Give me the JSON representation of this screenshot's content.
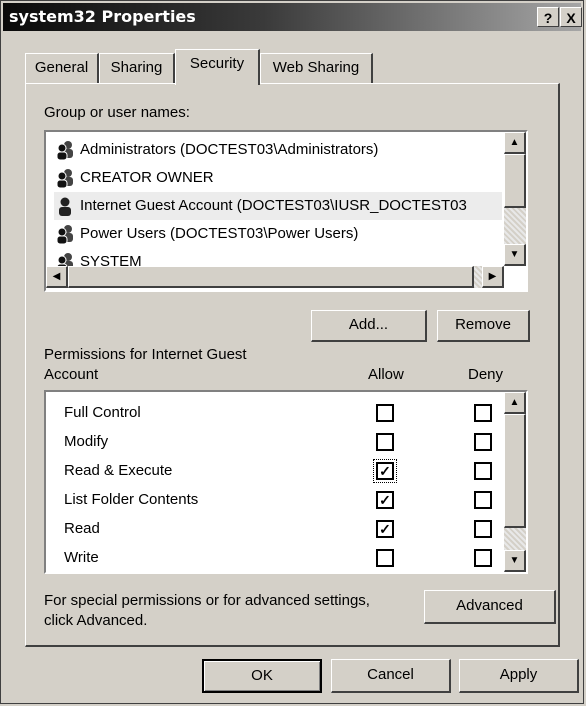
{
  "window": {
    "title": "system32 Properties",
    "help_glyph": "?",
    "close_glyph": "X"
  },
  "tabs": [
    {
      "label": "General"
    },
    {
      "label": "Sharing"
    },
    {
      "label": "Security"
    },
    {
      "label": "Web Sharing"
    }
  ],
  "groups": {
    "label": "Group or user names:",
    "items": [
      {
        "label": "Administrators (DOCTEST03\\Administrators)",
        "icon": "group-icon"
      },
      {
        "label": "CREATOR OWNER",
        "icon": "group-icon"
      },
      {
        "label": "Internet Guest Account (DOCTEST03\\IUSR_DOCTEST03",
        "icon": "user-icon",
        "selected": true
      },
      {
        "label": "Power Users (DOCTEST03\\Power Users)",
        "icon": "group-icon"
      },
      {
        "label": "SYSTEM",
        "icon": "group-icon"
      }
    ]
  },
  "buttons": {
    "add": "Add...",
    "remove": "Remove",
    "advanced": "Advanced",
    "ok": "OK",
    "cancel": "Cancel",
    "apply": "Apply"
  },
  "permissions": {
    "label_line1": "Permissions for Internet Guest",
    "label_line2": "Account",
    "allow_header": "Allow",
    "deny_header": "Deny",
    "rows": [
      {
        "name": "Full Control",
        "allow": false,
        "deny": false
      },
      {
        "name": "Modify",
        "allow": false,
        "deny": false
      },
      {
        "name": "Read & Execute",
        "allow": true,
        "deny": false
      },
      {
        "name": "List Folder Contents",
        "allow": true,
        "deny": false
      },
      {
        "name": "Read",
        "allow": true,
        "deny": false
      },
      {
        "name": "Write",
        "allow": false,
        "deny": false
      }
    ]
  },
  "advanced_text": {
    "line1": "For special permissions or for advanced settings,",
    "line2": "click Advanced."
  }
}
